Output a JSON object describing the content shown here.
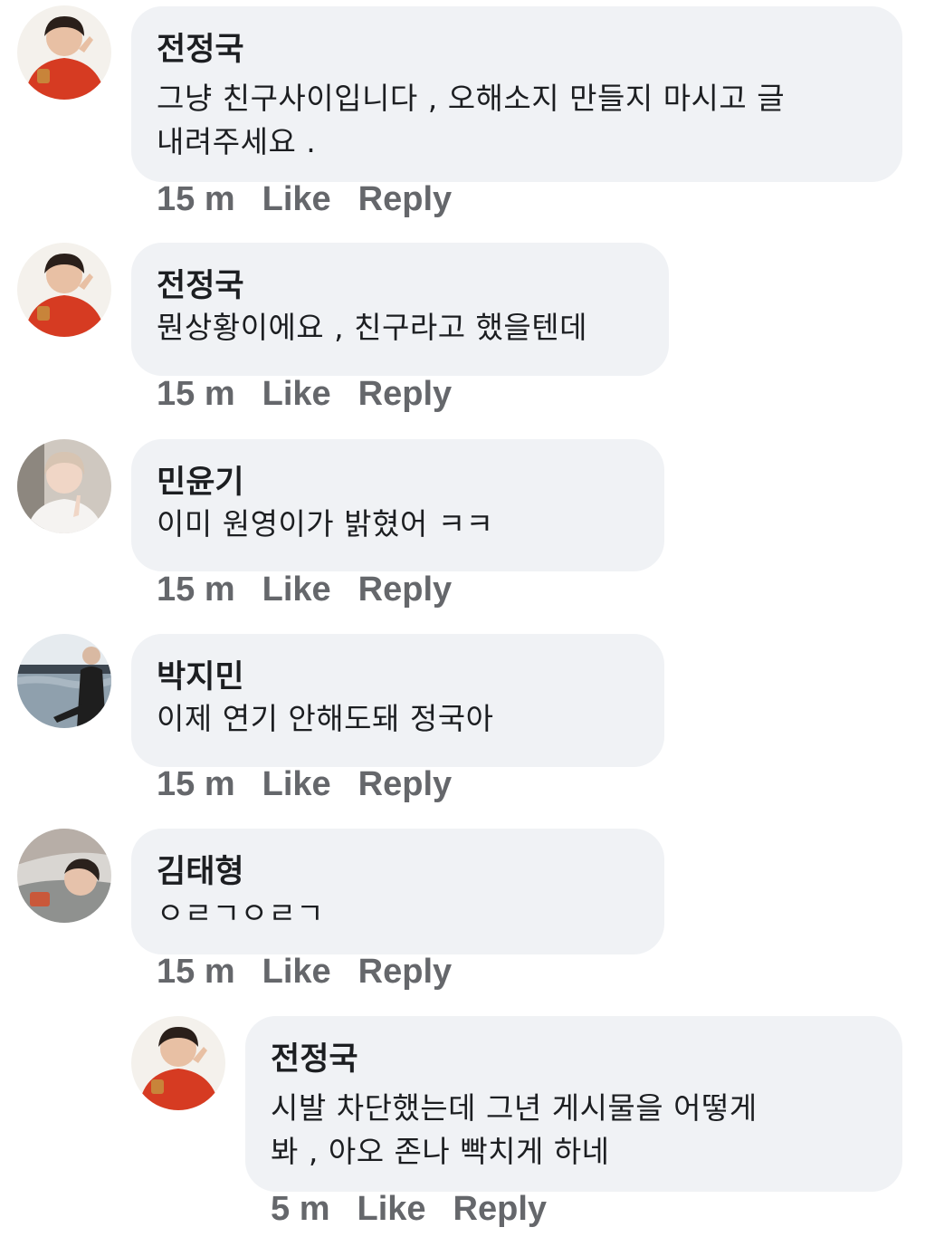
{
  "comments": [
    {
      "author": "전정국",
      "text_lines": [
        "그냥 친구사이입니다 , 오해소지 만들지 마시고 글",
        "내려주세요 ."
      ],
      "time": "15 m",
      "like": "Like",
      "reply": "Reply",
      "avatar": "avatar-red-jacket-icon"
    },
    {
      "author": "전정국",
      "text_lines": [
        "뭔상황이에요 , 친구라고 했을텐데"
      ],
      "time": "15 m",
      "like": "Like",
      "reply": "Reply",
      "avatar": "avatar-red-jacket-icon"
    },
    {
      "author": "민윤기",
      "text_lines": [
        "이미 원영이가 밝혔어 ㅋㅋ"
      ],
      "time": "15 m",
      "like": "Like",
      "reply": "Reply",
      "avatar": "avatar-peace-sign-icon"
    },
    {
      "author": "박지민",
      "text_lines": [
        "이제 연기 안해도돼 정국아"
      ],
      "time": "15 m",
      "like": "Like",
      "reply": "Reply",
      "avatar": "avatar-riverside-icon"
    },
    {
      "author": "김태형",
      "text_lines": [
        "ㅇㄹㄱㅇㄹㄱ"
      ],
      "time": "15 m",
      "like": "Like",
      "reply": "Reply",
      "avatar": "avatar-lying-down-icon"
    },
    {
      "author": "전정국",
      "text_lines": [
        "시발 차단했는데 그년 게시물을 어떻게",
        "봐 , 아오 존나 빡치게 하네"
      ],
      "time": "5 m",
      "like": "Like",
      "reply": "Reply",
      "avatar": "avatar-red-jacket-icon"
    }
  ],
  "colors": {
    "bubble": "#f0f2f5",
    "text": "#1c1e21",
    "meta": "#65676b"
  }
}
